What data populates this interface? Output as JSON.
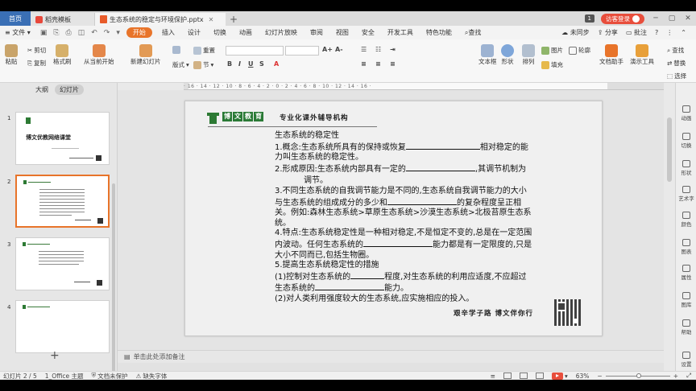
{
  "titlebar": {
    "home_tab": "首页",
    "template_tab": "稻壳模板",
    "doc_tab": "生态系统的稳定与环境保护.pptx",
    "new_tab": "+",
    "badge": "1",
    "login": "访客登录"
  },
  "menubar": {
    "file": "文件",
    "items": [
      "开始",
      "插入",
      "设计",
      "切换",
      "动画",
      "幻灯片放映",
      "审阅",
      "视图",
      "安全",
      "开发工具",
      "特色功能"
    ],
    "search": "查找",
    "sync": "未同步",
    "share": "分享",
    "comment": "批注"
  },
  "ribbon": {
    "paste": "粘贴",
    "cut": "剪切",
    "copy": "复制",
    "format_painter": "格式刷",
    "from_current": "从当前开始",
    "new_slide": "新建幻灯片",
    "layout": "版式",
    "section": "节",
    "reset": "重置",
    "textbox": "文本框",
    "shape": "形状",
    "arrange": "排列",
    "picture": "图片",
    "fill": "填充",
    "outline": "轮廓",
    "doc_assistant": "文档助手",
    "present_tools": "演示工具",
    "find": "查找",
    "replace": "替换",
    "select": "选择",
    "zero_a": "0",
    "zero_b": "0",
    "font_sizes": [
      "A+",
      "A-"
    ]
  },
  "ruler": {
    "labels": "· 16 · 14 · 12 · 10 · 8 · 6 · 4 · 2 · 0 · 2 · 4 · 6 · 8 · 10 · 12 · 14 · 16 ·"
  },
  "left_panel": {
    "tab_outline": "大纲",
    "tab_slides": "幻灯片",
    "slide_numbers": [
      "1",
      "2",
      "3",
      "4"
    ],
    "slide1_title": "博文优教网络课堂",
    "add": "+"
  },
  "slide": {
    "brand": [
      "博",
      "文",
      "教",
      "育"
    ],
    "tagline": "专业化课外辅导机构",
    "heading": "生态系统的稳定性",
    "p1a": "1.概念:生态系统所具有的保持或恢复",
    "p1b": "相对稳定的能力叫生态系统的稳定性。",
    "p2a": "2.形成原因:生态系统内部具有一定的",
    "p2b": ",其调节机制为",
    "p2c": "调节。",
    "p3a": "3.不同生态系统的自我调节能力是不同的,生态系统自我调节能力的大小与生态系统的组成成分的多少和",
    "p3b": "的复杂程度呈正相关。例如:森林生态系统>草原生态系统>沙漠生态系统>北极苔原生态系统。",
    "p4a": "4.特点:生态系统稳定性是一种相对稳定,不是恒定不变的,总是在一定范围内波动。任何生态系统的",
    "p4b": "能力都是有一定限度的,只是大小不同而已,包括生物圈。",
    "p5": "5.提高生态系统稳定性的措施",
    "p6a": "(1)控制对生态系统的",
    "p6b": "程度,对生态系统的利用应适度,不应超过生态系统的",
    "p6c": "能力。",
    "p7": "(2)对人类利用强度较大的生态系统,应实施相应的投入。",
    "motto": "艰辛学子路 博文伴你行"
  },
  "notes": {
    "placeholder": "单击此处添加备注"
  },
  "right_sidebar": [
    "动画",
    "切换",
    "形状",
    "艺术字",
    "颜色",
    "图表",
    "属性",
    "图库",
    "帮助",
    "设置"
  ],
  "statusbar": {
    "slide_count": "幻灯片 2 / 5",
    "theme": "1_Office 主题",
    "protect": "文档未保护",
    "missing_font": "缺失字体",
    "zoom": "63%",
    "minus": "−",
    "plus": "+"
  }
}
